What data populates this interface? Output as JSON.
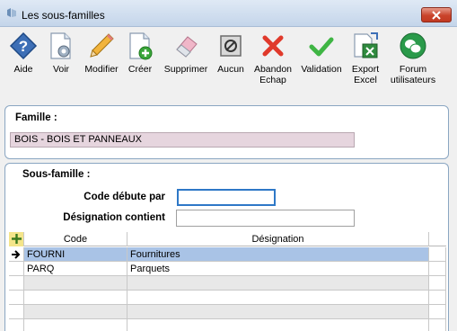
{
  "window": {
    "title": "Les sous-familles"
  },
  "toolbar": [
    {
      "label": "Aide",
      "icon": "help-icon"
    },
    {
      "label": "Voir",
      "icon": "view-icon"
    },
    {
      "label": "Modifier",
      "icon": "pencil-icon"
    },
    {
      "label": "Créer",
      "icon": "new-document-icon"
    },
    {
      "label": "Supprimer",
      "icon": "eraser-icon"
    },
    {
      "label": "Aucun",
      "icon": "none-icon"
    },
    {
      "label": "Abandon\nEchap",
      "icon": "cancel-icon"
    },
    {
      "label": "Validation",
      "icon": "checkmark-icon"
    },
    {
      "label": "Export\nExcel",
      "icon": "excel-export-icon"
    },
    {
      "label": "Forum\nutilisateurs",
      "icon": "forum-icon"
    }
  ],
  "famille": {
    "label": "Famille :",
    "value": "BOIS - BOIS ET PANNEAUX"
  },
  "sous_famille": {
    "label": "Sous-famille :",
    "code_label": "Code débute par",
    "code_value": "",
    "designation_label": "Désignation contient",
    "designation_value": ""
  },
  "grid": {
    "columns": [
      "Code",
      "Désignation"
    ],
    "rows": [
      {
        "code": "FOURNI",
        "designation": "Fournitures",
        "selected": true
      },
      {
        "code": "PARQ",
        "designation": "Parquets",
        "selected": false
      },
      {
        "code": "",
        "designation": "",
        "selected": false
      },
      {
        "code": "",
        "designation": "",
        "selected": false
      },
      {
        "code": "",
        "designation": "",
        "selected": false
      },
      {
        "code": "",
        "designation": "",
        "selected": false
      }
    ]
  }
}
